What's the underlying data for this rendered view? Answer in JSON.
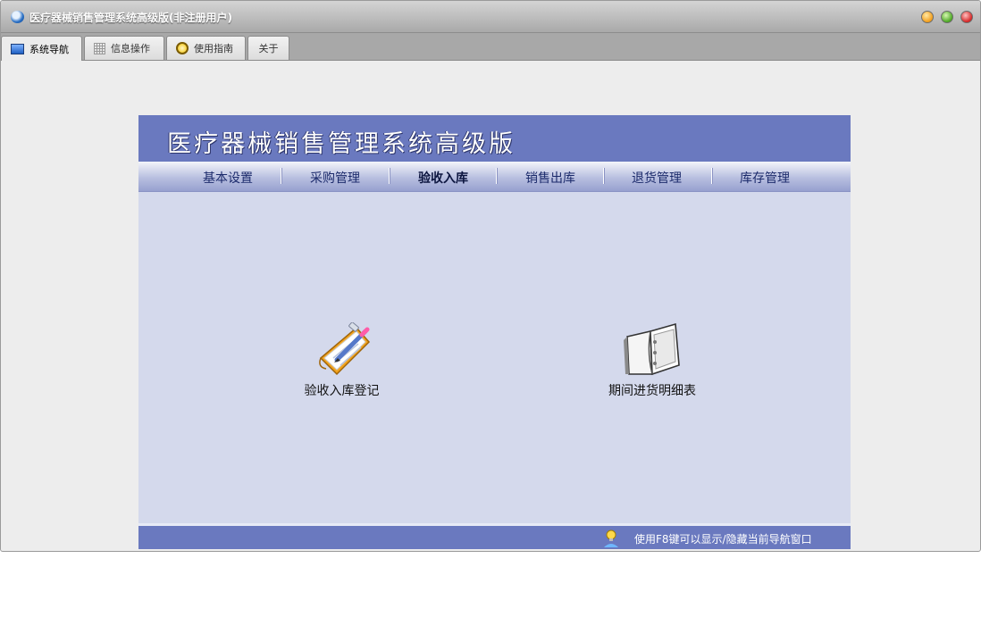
{
  "window": {
    "title": "医疗器械销售管理系统高级版(非注册用户)"
  },
  "tabs": [
    {
      "label": "系统导航",
      "icon": "monitor-icon"
    },
    {
      "label": "信息操作",
      "icon": "grid-icon"
    },
    {
      "label": "使用指南",
      "icon": "clock-icon"
    },
    {
      "label": "关于"
    }
  ],
  "banner": {
    "title": "医疗器械销售管理系统高级版"
  },
  "menu": [
    {
      "label": "基本设置"
    },
    {
      "label": "采购管理"
    },
    {
      "label": "验收入库"
    },
    {
      "label": "销售出库"
    },
    {
      "label": "退货管理"
    },
    {
      "label": "库存管理"
    }
  ],
  "launchers": [
    {
      "label": "验收入库登记",
      "icon": "clipboard-pencil-icon"
    },
    {
      "label": "期间进货明细表",
      "icon": "binder-icon"
    }
  ],
  "footer": {
    "hint": "使用F8键可以显示/隐藏当前导航窗口"
  },
  "colors": {
    "banner": "#6a79bf",
    "panel": "#d4d9ec",
    "tabbar": "#a8a8a8"
  }
}
